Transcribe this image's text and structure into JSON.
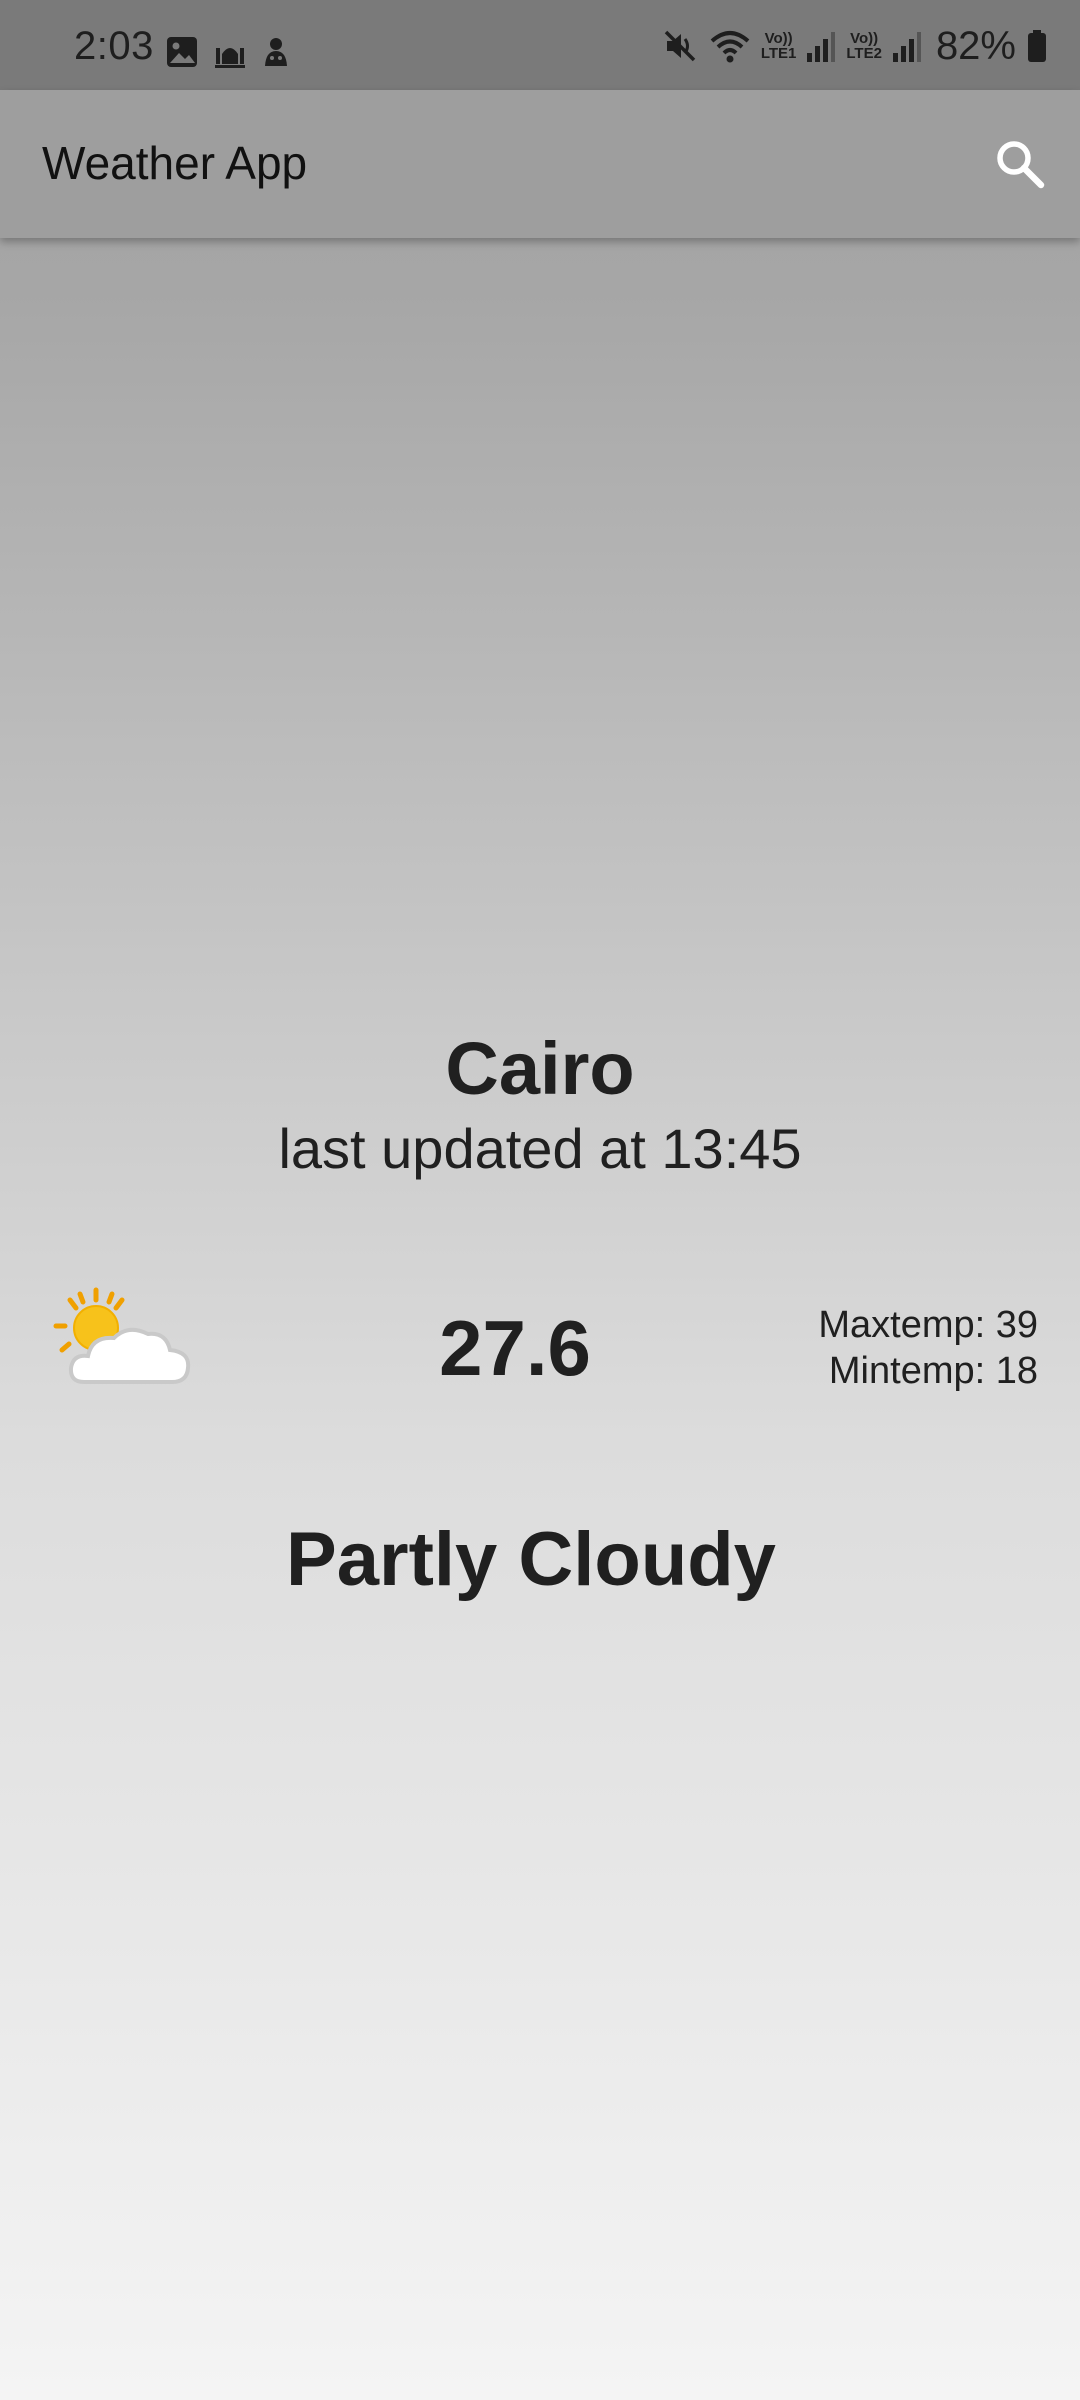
{
  "status_bar": {
    "time": "2:03",
    "left_icons": [
      "gallery-icon",
      "mosque-icon",
      "app-notification-icon"
    ],
    "right_icons": [
      "mute-icon",
      "wifi-icon",
      "signal-lte1-icon",
      "signal-lte2-icon",
      "battery-icon"
    ],
    "lte1_top": "Vo))",
    "lte1_bottom": "LTE1",
    "lte2_top": "Vo))",
    "lte2_bottom": "LTE2",
    "battery": "82%"
  },
  "app_bar": {
    "title": "Weather App",
    "search_icon": "search-icon"
  },
  "weather": {
    "city": "Cairo",
    "last_updated": "last updated at 13:45",
    "icon": "partly-cloudy-icon",
    "temperature": "27.6",
    "max_temp": "Maxtemp: 39",
    "min_temp": "Mintemp: 18",
    "condition": "Partly Cloudy"
  },
  "colors": {
    "status_bar_bg": "#7a7a7a",
    "app_bar_bg": "#9e9e9e",
    "text": "#202020",
    "sun": "#f7c21b",
    "sun_rays": "#f0a000"
  }
}
